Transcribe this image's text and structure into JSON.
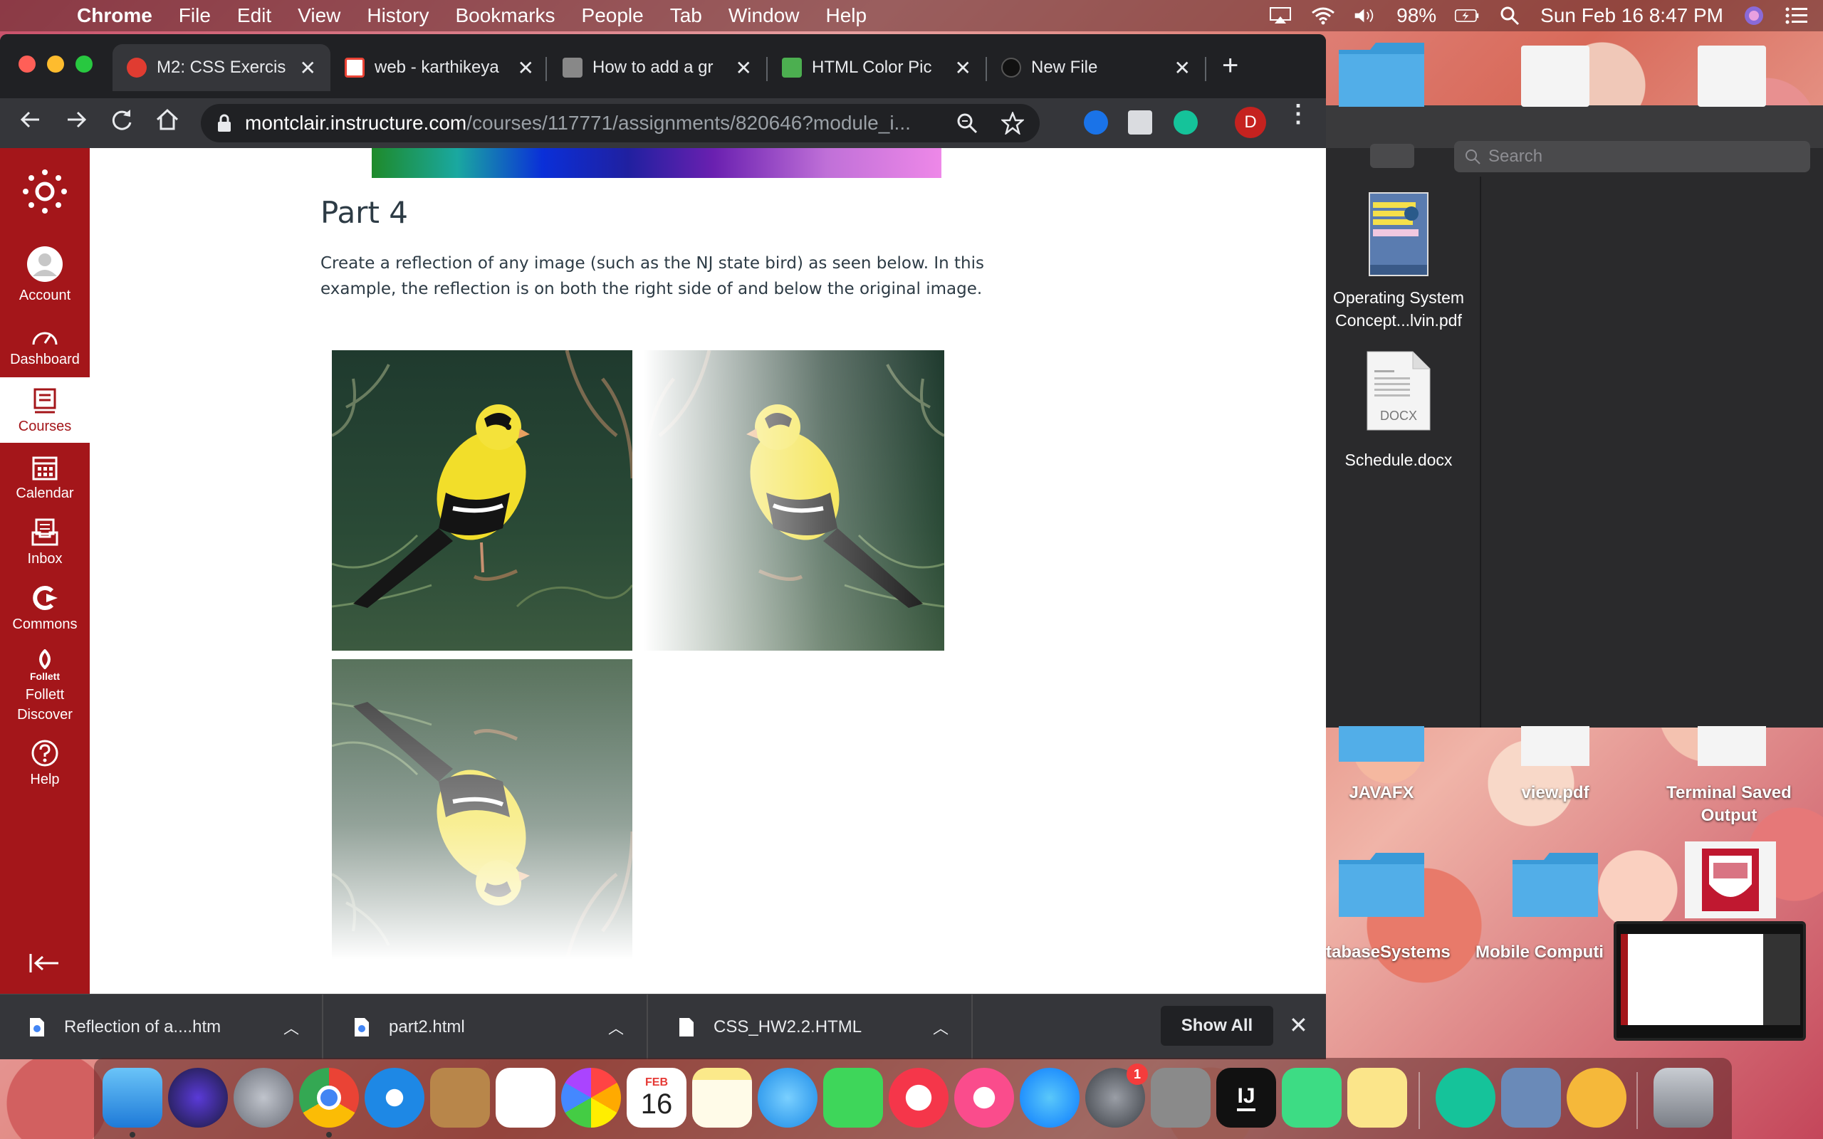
{
  "menubar": {
    "app": "Chrome",
    "menus": [
      "File",
      "Edit",
      "View",
      "History",
      "Bookmarks",
      "People",
      "Tab",
      "Window",
      "Help"
    ],
    "battery": "98%",
    "datetime": "Sun Feb 16  8:47 PM"
  },
  "tabs": [
    {
      "title": "M2: CSS Exercis",
      "color": "#e03c31"
    },
    {
      "title": "web - karthikeya",
      "color": "#ea4335"
    },
    {
      "title": "How to add a gr",
      "color": "#888888"
    },
    {
      "title": "HTML Color Pic",
      "color": "#4caf50"
    },
    {
      "title": "New File",
      "color": "#202124"
    }
  ],
  "omnibox": {
    "host": "montclair.instructure.com",
    "path": "/courses/117771/assignments/820646?module_i..."
  },
  "profile_initial": "D",
  "canvas_nav": [
    {
      "label": "Account",
      "icon": "account-icon"
    },
    {
      "label": "Dashboard",
      "icon": "dashboard-icon"
    },
    {
      "label": "Courses",
      "icon": "courses-icon"
    },
    {
      "label": "Calendar",
      "icon": "calendar-icon"
    },
    {
      "label": "Inbox",
      "icon": "inbox-icon"
    },
    {
      "label": "Commons",
      "icon": "commons-icon"
    },
    {
      "label": "Follett Discover",
      "icon": "follett-icon",
      "sublabel": "Follett"
    },
    {
      "label": "Help",
      "icon": "help-icon"
    }
  ],
  "content": {
    "title": "Part 4",
    "description": "Create a reflection of any image (such as the NJ state bird) as seen below. In this example, the reflection is on both the right side of and below the original image."
  },
  "finder": {
    "search_placeholder": "Search",
    "files": [
      {
        "name": "Operating System Concept...lvin.pdf",
        "icon": "pdf-book-icon"
      },
      {
        "name": "Schedule.docx",
        "icon": "docx-icon",
        "badge": "DOCX"
      }
    ]
  },
  "desktop": {
    "items": [
      {
        "label": "JAVAFX"
      },
      {
        "label": "view.pdf"
      },
      {
        "label": "Terminal Saved Output"
      },
      {
        "label": "tabaseSystems"
      },
      {
        "label": "Mobile Computi"
      }
    ]
  },
  "downloads": [
    {
      "name": "Reflection of a....htm"
    },
    {
      "name": "part2.html"
    },
    {
      "name": "CSS_HW2.2.HTML"
    }
  ],
  "shelf": {
    "show_all": "Show All"
  },
  "dock": {
    "calendar_month": "FEB",
    "calendar_day": "16",
    "badge_count": "1"
  }
}
